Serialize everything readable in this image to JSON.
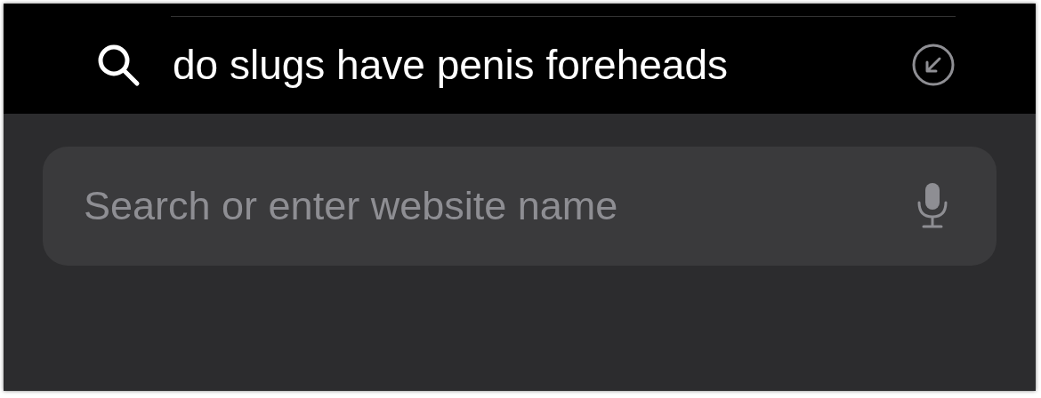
{
  "suggestions": [
    {
      "text": "do slugs have penis foreheads"
    }
  ],
  "address_bar": {
    "placeholder": "Search or enter website name"
  }
}
